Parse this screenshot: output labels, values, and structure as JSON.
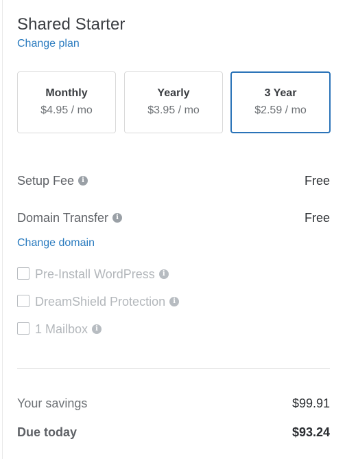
{
  "plan": {
    "title": "Shared Starter",
    "change_plan_label": "Change plan"
  },
  "terms": [
    {
      "name": "Monthly",
      "price": "$4.95 / mo",
      "selected": false
    },
    {
      "name": "Yearly",
      "price": "$3.95 / mo",
      "selected": false
    },
    {
      "name": "3 Year",
      "price": "$2.59 / mo",
      "selected": true
    }
  ],
  "fees": {
    "setup_fee_label": "Setup Fee",
    "setup_fee_value": "Free",
    "domain_transfer_label": "Domain Transfer",
    "domain_transfer_value": "Free",
    "change_domain_label": "Change domain"
  },
  "addons": [
    {
      "label": "Pre-Install WordPress",
      "checked": false
    },
    {
      "label": "DreamShield Protection",
      "checked": false
    },
    {
      "label": "1 Mailbox",
      "checked": false
    }
  ],
  "info_icon_glyph": "i",
  "summary": {
    "savings_label": "Your savings",
    "savings_value": "$99.91",
    "due_label": "Due today",
    "due_value": "$93.24"
  },
  "colors": {
    "link": "#2a7bbf",
    "selected_border": "#2a73b8",
    "disabled_text": "#b3b7bb"
  }
}
